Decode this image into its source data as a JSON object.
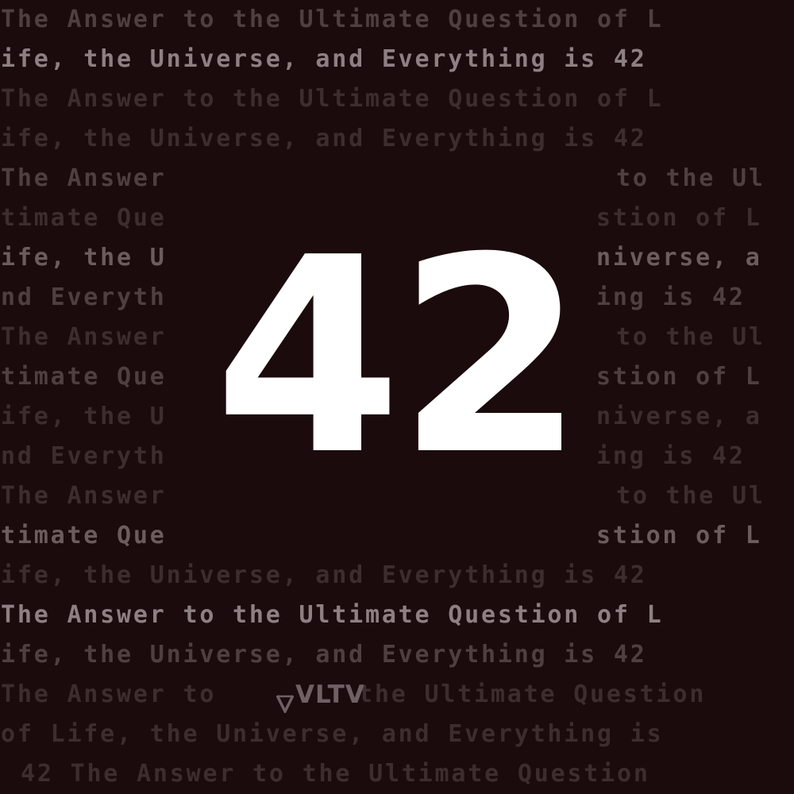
{
  "colors": {
    "background": "#1b0b0c",
    "number": "#ffffff",
    "text_faint": "#3e2c2e",
    "text_dim": "#4f3f41",
    "text_mid": "#6c5c5e",
    "text_bright": "#8e8082",
    "logo": "#6f6163"
  },
  "hero": {
    "number": "42"
  },
  "logo": {
    "text": "VLTV"
  },
  "lines": [
    {
      "tone": "dim",
      "segments": [
        {
          "col": 0,
          "text": "The Answer to the Ultimate Question of L"
        }
      ]
    },
    {
      "tone": "bright",
      "segments": [
        {
          "col": 0,
          "text": "ife, the Universe, and Everything is 42"
        }
      ]
    },
    {
      "tone": "faint",
      "segments": [
        {
          "col": 0,
          "text": "The Answer to the Ultimate Question of L"
        }
      ]
    },
    {
      "tone": "faint",
      "segments": [
        {
          "col": 0,
          "text": "ife, the Universe, and Everything is 42"
        }
      ]
    },
    {
      "tone": "dim",
      "segments": [
        {
          "col": 0,
          "text": "The Answer"
        },
        {
          "col": 31,
          "text": "to the Ul"
        }
      ]
    },
    {
      "tone": "faint",
      "segments": [
        {
          "col": 0,
          "text": "timate Que"
        },
        {
          "col": 30,
          "text": "stion of L"
        }
      ]
    },
    {
      "tone": "mid",
      "segments": [
        {
          "col": 0,
          "text": "ife, the U"
        },
        {
          "col": 30,
          "text": "niverse, a"
        }
      ]
    },
    {
      "tone": "dim",
      "segments": [
        {
          "col": 0,
          "text": "nd Everyth"
        },
        {
          "col": 30,
          "text": "ing is 42"
        }
      ]
    },
    {
      "tone": "faint",
      "segments": [
        {
          "col": 0,
          "text": "The Answer"
        },
        {
          "col": 31,
          "text": "to the Ul"
        }
      ]
    },
    {
      "tone": "dim",
      "segments": [
        {
          "col": 0,
          "text": "timate Que"
        },
        {
          "col": 30,
          "text": "stion of L"
        }
      ]
    },
    {
      "tone": "faint",
      "segments": [
        {
          "col": 0,
          "text": "ife, the U"
        },
        {
          "col": 30,
          "text": "niverse, a"
        }
      ]
    },
    {
      "tone": "faint",
      "segments": [
        {
          "col": 0,
          "text": "nd Everyth"
        },
        {
          "col": 30,
          "text": "ing is 42"
        }
      ]
    },
    {
      "tone": "faint",
      "segments": [
        {
          "col": 0,
          "text": "The Answer"
        },
        {
          "col": 31,
          "text": "to the Ul"
        }
      ]
    },
    {
      "tone": "mid",
      "segments": [
        {
          "col": 0,
          "text": "timate Que"
        },
        {
          "col": 30,
          "text": "stion of L"
        }
      ]
    },
    {
      "tone": "faint",
      "segments": [
        {
          "col": 0,
          "text": "ife, the Universe, and Everything is 42"
        }
      ]
    },
    {
      "tone": "bright",
      "segments": [
        {
          "col": 0,
          "text": "The Answer to the Ultimate Question of L"
        }
      ]
    },
    {
      "tone": "dim",
      "segments": [
        {
          "col": 0,
          "text": "ife, the Universe, and Everything is 42"
        }
      ]
    },
    {
      "tone": "faint",
      "segments": [
        {
          "col": 0,
          "text": "The Answer to"
        },
        {
          "col": 18,
          "text": "the Ultimate Question"
        }
      ]
    },
    {
      "tone": "faint",
      "segments": [
        {
          "col": 0,
          "text": "of Life, the Universe, and Everything is"
        }
      ]
    },
    {
      "tone": "faint",
      "segments": [
        {
          "col": 1,
          "text": "42 The Answer to the Ultimate Question"
        }
      ]
    }
  ]
}
